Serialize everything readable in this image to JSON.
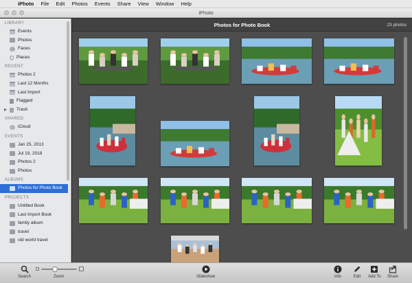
{
  "menubar": {
    "apple_icon": "apple-logo-icon",
    "app": "iPhoto",
    "items": [
      "File",
      "Edit",
      "Photos",
      "Events",
      "Share",
      "View",
      "Window",
      "Help"
    ]
  },
  "window": {
    "title": "iPhoto"
  },
  "sidebar": {
    "sections": [
      {
        "header": "LIBRARY",
        "items": [
          {
            "label": "Events",
            "icon": "events-icon"
          },
          {
            "label": "Photos",
            "icon": "photos-icon"
          },
          {
            "label": "Faces",
            "icon": "faces-icon"
          },
          {
            "label": "Places",
            "icon": "places-icon"
          }
        ]
      },
      {
        "header": "RECENT",
        "items": [
          {
            "label": "Photos 2",
            "icon": "calendar-icon"
          },
          {
            "label": "Last 12 Months",
            "icon": "calendar-icon"
          },
          {
            "label": "Last Import",
            "icon": "calendar-icon"
          },
          {
            "label": "Flagged",
            "icon": "flag-icon"
          },
          {
            "label": "Trash",
            "icon": "trash-icon"
          }
        ]
      },
      {
        "header": "SHARED",
        "items": [
          {
            "label": "iCloud",
            "icon": "cloud-icon"
          }
        ]
      },
      {
        "header": "EVENTS",
        "items": [
          {
            "label": "Jan 25, 2013",
            "icon": "event-icon"
          },
          {
            "label": "Jul 19, 2018",
            "icon": "event-icon"
          },
          {
            "label": "Photos 2",
            "icon": "event-icon"
          },
          {
            "label": "Photos",
            "icon": "event-icon"
          }
        ]
      },
      {
        "header": "ALBUMS",
        "items": [
          {
            "label": "Photos for Photo Book",
            "icon": "album-icon",
            "selected": true
          }
        ]
      },
      {
        "header": "PROJECTS",
        "items": [
          {
            "label": "Untitled Book",
            "icon": "book-icon"
          },
          {
            "label": "Last Import Book",
            "icon": "book-icon"
          },
          {
            "label": "family album",
            "icon": "book-icon"
          },
          {
            "label": "travel",
            "icon": "book-icon"
          },
          {
            "label": "old world travel",
            "icon": "book-icon"
          }
        ]
      }
    ]
  },
  "main": {
    "title": "Photos for Photo Book",
    "count": "23 photos",
    "photos": [
      {
        "scene": "family-picnic",
        "orientation": "landscape"
      },
      {
        "scene": "family-picnic",
        "orientation": "landscape"
      },
      {
        "scene": "boat-lake",
        "orientation": "landscape"
      },
      {
        "scene": "boat-lake",
        "orientation": "landscape"
      },
      {
        "scene": "boat-dock",
        "orientation": "portrait"
      },
      {
        "scene": "boat-lake",
        "orientation": "landscape"
      },
      {
        "scene": "boat-dock",
        "orientation": "portrait"
      },
      {
        "scene": "camping-tent",
        "orientation": "portrait"
      },
      {
        "scene": "kids-camping",
        "orientation": "landscape"
      },
      {
        "scene": "kids-camping",
        "orientation": "landscape"
      },
      {
        "scene": "kids-camping",
        "orientation": "landscape"
      },
      {
        "scene": "kids-camping",
        "orientation": "landscape"
      },
      {
        "scene": "partial",
        "orientation": "landscape"
      }
    ]
  },
  "toolbar": {
    "search": "Search",
    "zoom": "Zoom",
    "slideshow": "Slideshow",
    "info": "Info",
    "edit": "Edit",
    "add_to": "Add To",
    "share": "Share"
  }
}
